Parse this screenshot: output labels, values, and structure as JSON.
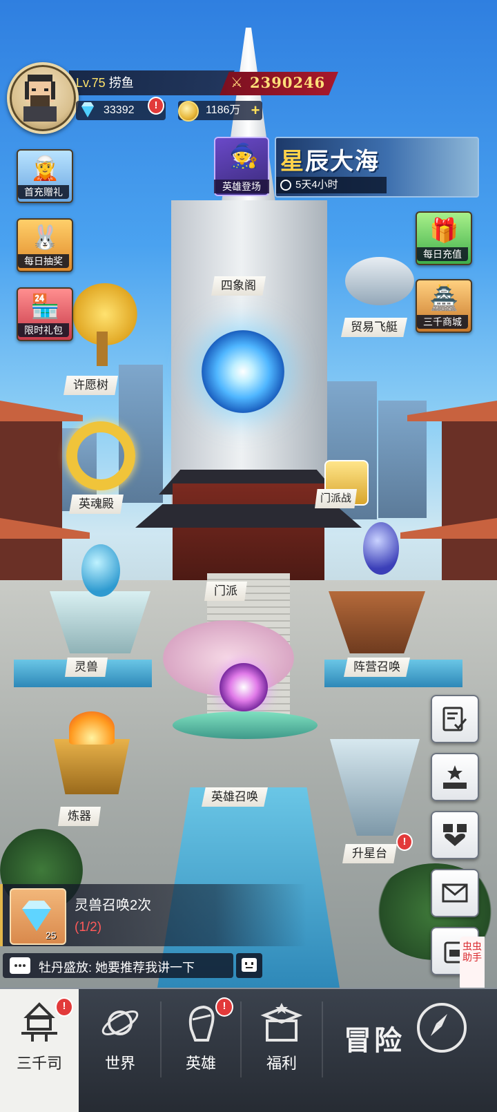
{
  "player": {
    "level_prefix": "Lv.75",
    "name": "捞鱼",
    "power": "2390246",
    "gems": "33392",
    "gold": "1186万"
  },
  "left_events": [
    {
      "label": "首充赠礼"
    },
    {
      "label": "每日抽奖"
    },
    {
      "label": "限时礼包"
    }
  ],
  "top_events": {
    "hero_debut": "英雄登场",
    "star_sea_title_highlight": "星",
    "star_sea_title_rest": "辰大海",
    "star_sea_countdown": "5天4小时"
  },
  "right_events": [
    {
      "label": "每日充值"
    },
    {
      "label": "三千商城"
    }
  ],
  "buildings": {
    "sixiang": "四象阁",
    "trade_airship": "贸易飞艇",
    "wish_tree": "许愿树",
    "soul_hall": "英魂殿",
    "sect_war": "门派战",
    "sect": "门派",
    "spirit_beast": "灵兽",
    "faction_summon": "阵营召唤",
    "hero_summon": "英雄召唤",
    "forge": "炼器",
    "star_platform": "升星台"
  },
  "quest": {
    "title": "灵兽召唤2次",
    "progress": "(1/2)",
    "reward_count": "25"
  },
  "chat": {
    "message": "牡丹盛放: 她要推荐我讲一下"
  },
  "helper": {
    "label": "虫虫助手"
  },
  "alert_mark": "!",
  "nav": {
    "tabs": [
      {
        "label": "三千司"
      },
      {
        "label": "世界"
      },
      {
        "label": "英雄"
      },
      {
        "label": "福利"
      }
    ],
    "adventure": "冒险"
  },
  "colors": {
    "power_banner": "#a8192c",
    "alert": "#e23a3a",
    "gold_text": "#ffe07a"
  }
}
